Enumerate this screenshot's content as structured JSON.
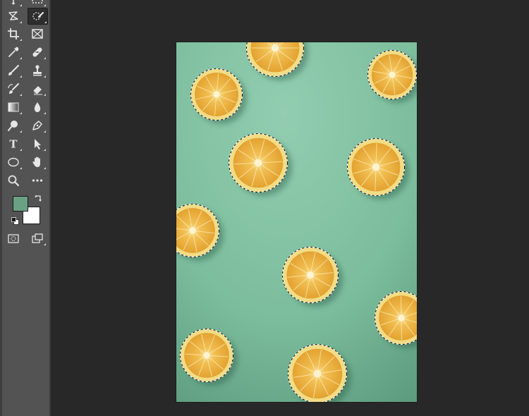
{
  "app": {
    "tools_active": "quick-selection",
    "colors": {
      "foreground": "#6aa184",
      "background": "#ffffff",
      "panel": "#535353",
      "workspace": "#282828"
    }
  },
  "toolbar": {
    "tools": [
      {
        "name": "move-tool-icon"
      },
      {
        "name": "marquee-tool-icon"
      },
      {
        "name": "lasso-tool-icon"
      },
      {
        "name": "quick-selection-tool-icon",
        "active": true
      },
      {
        "name": "crop-tool-icon"
      },
      {
        "name": "frame-tool-icon"
      },
      {
        "name": "eyedropper-tool-icon"
      },
      {
        "name": "healing-brush-tool-icon"
      },
      {
        "name": "brush-tool-icon"
      },
      {
        "name": "clone-stamp-tool-icon"
      },
      {
        "name": "history-brush-tool-icon"
      },
      {
        "name": "eraser-tool-icon"
      },
      {
        "name": "gradient-tool-icon"
      },
      {
        "name": "blur-tool-icon"
      },
      {
        "name": "dodge-tool-icon"
      },
      {
        "name": "pen-tool-icon"
      },
      {
        "name": "type-tool-icon"
      },
      {
        "name": "path-selection-tool-icon"
      },
      {
        "name": "ellipse-tool-icon"
      },
      {
        "name": "hand-tool-icon"
      },
      {
        "name": "zoom-tool-icon"
      },
      {
        "name": "more-tools-icon"
      },
      {
        "name": "quick-mask-icon"
      },
      {
        "name": "screen-mode-icon"
      }
    ],
    "type_tool_glyph": "T"
  },
  "canvas": {
    "image_description_colors": {
      "backdrop": "#7dbd9e",
      "lemon_rind": "#f2dc86",
      "lemon_flesh": "#e7a832",
      "lemon_center": "#fff3cf"
    }
  }
}
